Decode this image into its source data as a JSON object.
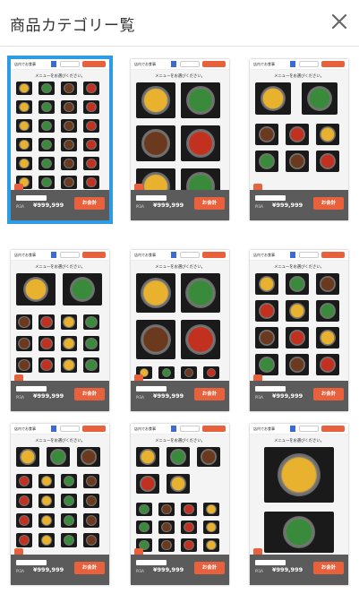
{
  "header": {
    "title": "商品カテゴリー覧",
    "close_icon": "close-icon"
  },
  "cards": [
    {
      "id": "layout-1",
      "selected": true,
      "layout": "grid-4x6"
    },
    {
      "id": "layout-2",
      "selected": false,
      "layout": "large-2x2"
    },
    {
      "id": "layout-3",
      "selected": false,
      "layout": "mixed-2-then-3"
    },
    {
      "id": "layout-4",
      "selected": false,
      "layout": "mixed-2-then-4"
    },
    {
      "id": "layout-5",
      "selected": false,
      "layout": "large-2-then-4"
    },
    {
      "id": "layout-6",
      "selected": false,
      "layout": "mixed-3-3"
    },
    {
      "id": "layout-7",
      "selected": false,
      "layout": "mixed-3-4"
    },
    {
      "id": "layout-8",
      "selected": false,
      "layout": "mixed-3-2-4"
    },
    {
      "id": "layout-9",
      "selected": false,
      "layout": "single-large"
    }
  ],
  "card_texts": {
    "shop_name": "店内でお食事",
    "prompt": "メニューをお選びください。",
    "footer_label": "Pl3A",
    "price": "¥999,999",
    "pay_label": "お会計"
  },
  "colors": {
    "accent": "#e8603c",
    "selected_border": "#2e9be4",
    "footer_bg": "#5b5b5b",
    "flag_blue": "#3a6ad6"
  }
}
